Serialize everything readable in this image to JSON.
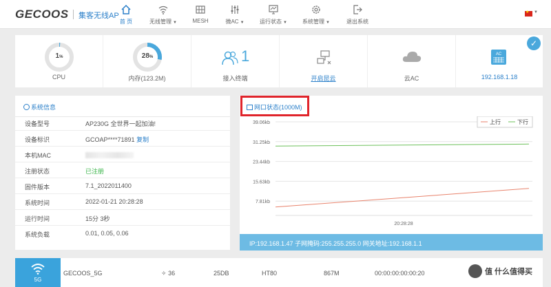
{
  "brand": {
    "logo": "GECOOS",
    "subtitle": "集客无线AP"
  },
  "nav": [
    {
      "label": "首 页",
      "icon": "home-icon",
      "active": true,
      "caret": false
    },
    {
      "label": "无线管理",
      "icon": "wifi-icon",
      "active": false,
      "caret": true
    },
    {
      "label": "MESH",
      "icon": "mesh-icon",
      "active": false,
      "caret": false
    },
    {
      "label": "微AC",
      "icon": "sliders-icon",
      "active": false,
      "caret": true
    },
    {
      "label": "运行状态",
      "icon": "monitor-icon",
      "active": false,
      "caret": true
    },
    {
      "label": "系统管理",
      "icon": "gear-icon",
      "active": false,
      "caret": true
    },
    {
      "label": "退出系统",
      "icon": "logout-icon",
      "active": false,
      "caret": false
    }
  ],
  "stats": {
    "cpu": {
      "value": "1",
      "unit": "%",
      "label": "CPU",
      "percent": 1
    },
    "memory": {
      "value": "28",
      "unit": "%",
      "label": "内存(123.2M)",
      "percent": 28
    },
    "clients": {
      "value": "1",
      "label": "接入终端"
    },
    "cloud_open": {
      "label": "开启昆云"
    },
    "cloud_ac": {
      "label": "云AC"
    },
    "ac": {
      "badge": "AC",
      "label": "192.168.1.18"
    }
  },
  "system_info": {
    "title": "系统信息",
    "rows": [
      {
        "key": "设备型号",
        "value": "AP230G 全世界一起加油!"
      },
      {
        "key": "设备标识",
        "value": "GCOAP****71891",
        "link": "复制"
      },
      {
        "key": "本机MAC",
        "value": ""
      },
      {
        "key": "注册状态",
        "value": "已注册",
        "status": "green"
      },
      {
        "key": "固件版本",
        "value": "7.1_2022011400"
      },
      {
        "key": "系统时间",
        "value": "2022-01-21 20:28:28"
      },
      {
        "key": "运行时间",
        "value": "15分 3秒"
      },
      {
        "key": "系统负载",
        "value": "0.01, 0.05, 0.06"
      }
    ]
  },
  "network": {
    "title": "网口状态(1000M)",
    "footer": "IP:192.168.1.47  子网掩码:255.255.255.0  网关地址:192.168.1.1"
  },
  "chart_data": {
    "type": "line",
    "yticks": [
      "39.06kb",
      "31.25kb",
      "23.44kb",
      "15.63kb",
      "7.81kb"
    ],
    "ytick_values": [
      39.06,
      31.25,
      23.44,
      15.63,
      7.81
    ],
    "ylim": [
      0,
      39.06
    ],
    "xticks": [
      "20:28:28"
    ],
    "grid": true,
    "legend_position": "top-right",
    "series": [
      {
        "name": "上行",
        "color": "#e8826b",
        "values": [
          5.5,
          12.8
        ]
      },
      {
        "name": "下行",
        "color": "#6cc05a",
        "values": [
          29.5,
          30.3
        ]
      }
    ]
  },
  "bottom_row": {
    "band": "5G",
    "ssid": "GECOOS_5G",
    "channel": "36",
    "power": "25DB",
    "mode": "HT80",
    "rate": "867M",
    "mac": "00:00:00:00:00:20"
  },
  "watermark": "值 什么值得买"
}
